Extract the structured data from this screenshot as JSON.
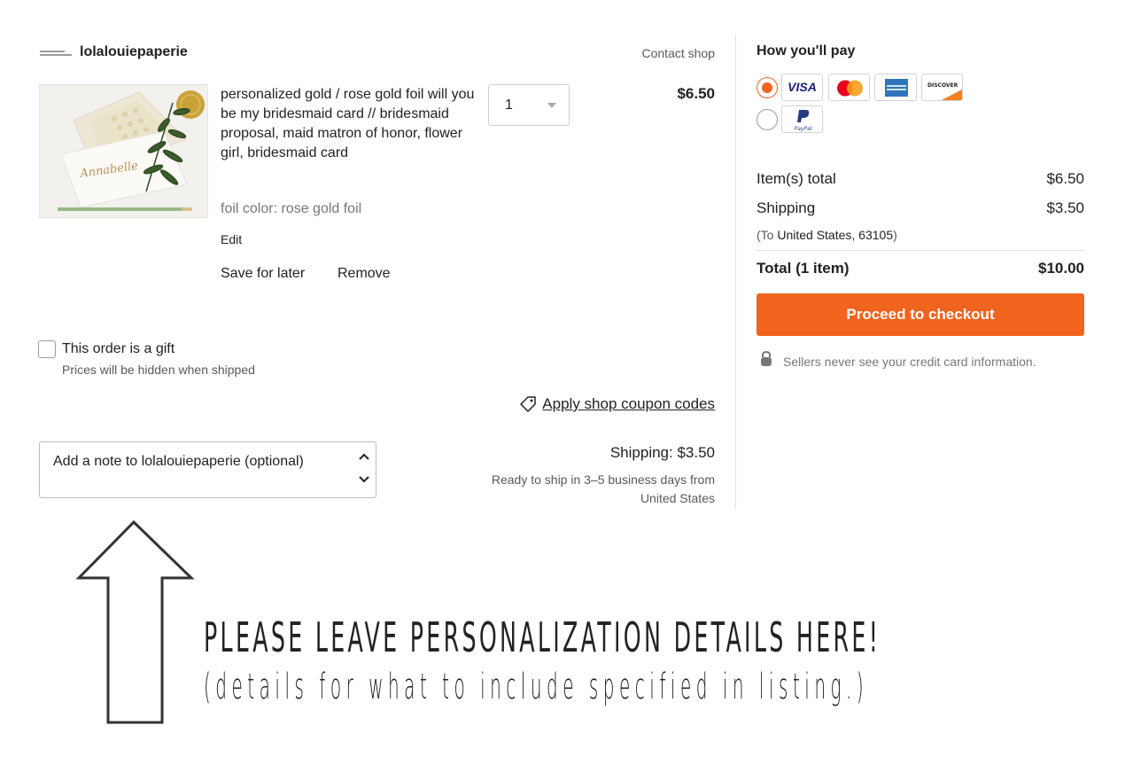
{
  "shop": {
    "name": "lolalouiepaperie",
    "contact_label": "Contact shop"
  },
  "item": {
    "title": "personalized gold / rose gold foil will you be my bridesmaid card // bridesmaid proposal, maid matron of honor, flower girl, bridesmaid card",
    "variation": "foil color: rose gold foil",
    "edit_label": "Edit",
    "save_label": "Save for later",
    "remove_label": "Remove",
    "quantity": "1",
    "price": "$6.50",
    "image_script_text": "Annabelle"
  },
  "gift": {
    "label": "This order is a gift",
    "sublabel": "Prices will be hidden when shipped"
  },
  "coupon": {
    "label": "Apply shop coupon codes"
  },
  "note": {
    "placeholder": "Add a note to lolalouiepaperie (optional)"
  },
  "shipping": {
    "cost_label": "Shipping: $3.50",
    "ready_text": "Ready to ship in 3–5 business days from United States"
  },
  "payment": {
    "heading": "How you'll pay",
    "selected_method": "card",
    "card_logos": [
      "visa-logo",
      "mastercard-logo",
      "amex-logo",
      "discover-logo"
    ],
    "visa_text": "VISA",
    "discover_text": "DISCOVER",
    "paypal_text": "PayPal"
  },
  "summary": {
    "items_label": "Item(s) total",
    "items_value": "$6.50",
    "shipping_label": "Shipping",
    "shipping_value": "$3.50",
    "destination_prefix": "(To ",
    "destination": "United States, 63105",
    "destination_suffix": ")",
    "total_label": "Total (1 item)",
    "total_value": "$10.00",
    "checkout_label": "Proceed to checkout",
    "secure_note": "Sellers never see your credit card information."
  },
  "annotation": {
    "line1": "PLEASE LEAVE PERSONALIZATION DETAILS HERE!",
    "line2": "(details for what to include specified in listing.)"
  },
  "colors": {
    "accent": "#f1641e",
    "text": "#222222",
    "muted": "#595959",
    "divider": "#e1e1e1"
  }
}
